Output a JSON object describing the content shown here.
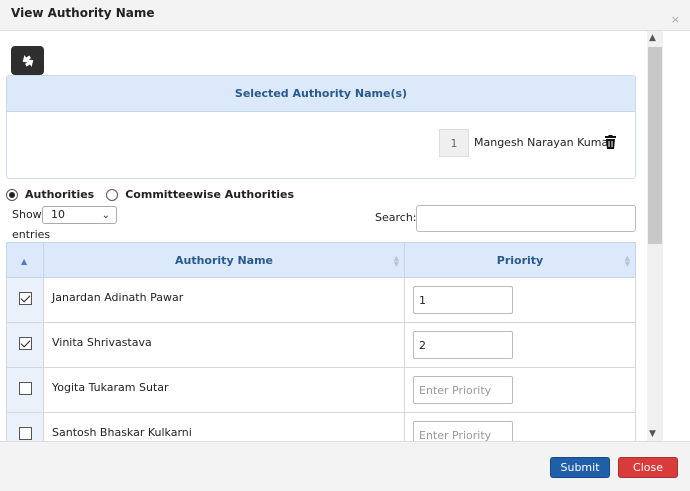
{
  "dialog": {
    "title": "View Authority Name",
    "close_glyph": "×"
  },
  "selected": {
    "header": "Selected Authority Name(s)",
    "items": [
      {
        "number": "1",
        "name": "Mangesh Narayan Kuman"
      }
    ]
  },
  "filter": {
    "option_authorities": "Authorities",
    "option_committeewise": "Committeewise Authorities",
    "selected": "Authorities"
  },
  "list_controls": {
    "show_label": "Show",
    "show_value": "10",
    "entries_label": "entries",
    "search_label": "Search:",
    "search_value": ""
  },
  "table": {
    "columns": [
      "Authority Name",
      "Priority"
    ],
    "rows": [
      {
        "checked": true,
        "name": "Janardan Adinath Pawar",
        "priority": "1",
        "placeholder": "Enter Priority"
      },
      {
        "checked": true,
        "name": "Vinita Shrivastava",
        "priority": "2",
        "placeholder": "Enter Priority"
      },
      {
        "checked": false,
        "name": "Yogita Tukaram Sutar",
        "priority": "",
        "placeholder": "Enter Priority"
      },
      {
        "checked": false,
        "name": "Santosh Bhaskar Kulkarni",
        "priority": "",
        "placeholder": "Enter Priority"
      }
    ]
  },
  "footer": {
    "submit_label": "Submit",
    "close_label": "Close"
  },
  "icons": {
    "refresh": "refresh-icon",
    "trash": "trash-icon",
    "sort": "sort-icon"
  },
  "colors": {
    "header_blue": "#dbe9fb",
    "title_blue": "#2a5a8c",
    "submit": "#1f5ea8",
    "close": "#d93a3a"
  }
}
